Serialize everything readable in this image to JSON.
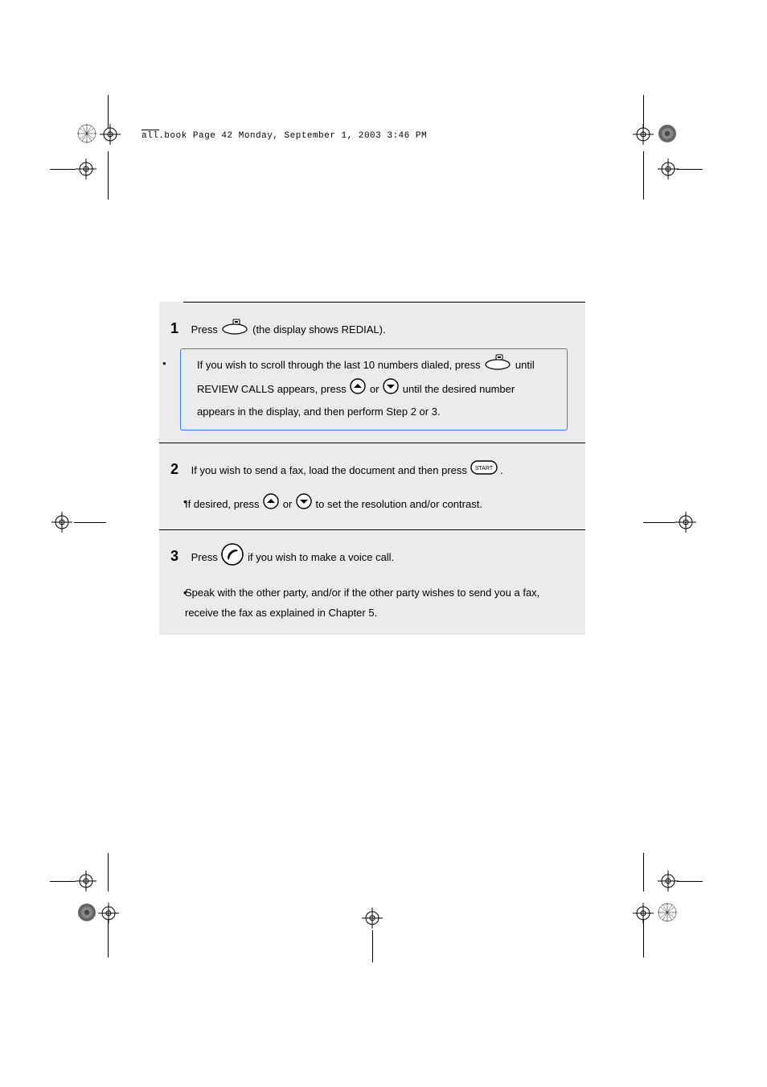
{
  "header": {
    "tag": "all.book  Page 42  Monday, September 1, 2003  3:46 PM"
  },
  "content": {
    "step1": {
      "num": "1",
      "line1_pre": "Press ",
      "line1_post": " (the display shows REDIAL)."
    },
    "step1_bullet": {
      "line_a": "If you wish to scroll through the last 10 numbers dialed, press ",
      "line_a_post": " until",
      "line_b": "REVIEW CALLS appears, press ",
      "line_c": " or ",
      "line_d": " until the desired number",
      "line_e": "appears in the display, and then perform Step 2 or 3."
    },
    "step2": {
      "num": "2",
      "line1": "If you wish to send a fax, load the document and then press ",
      "line1_post": "."
    },
    "step2_bullet": {
      "line": "If desired, press ",
      "line_mid": " or ",
      "line_end": " to set the resolution and/or contrast."
    },
    "step3": {
      "num": "3",
      "line1": "Press ",
      "line1_post": " if you wish to make a voice call."
    },
    "step3_bullet": {
      "line": "Speak with the other party, and/or if the other party wishes to send you a fax, receive the fax as explained in Chapter 5."
    }
  }
}
